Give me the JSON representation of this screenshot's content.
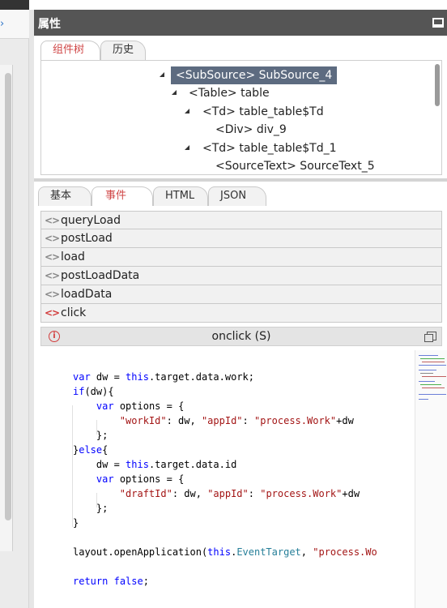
{
  "panel": {
    "title": "属性"
  },
  "top_tabs": [
    "组件树",
    "历史"
  ],
  "tree": [
    {
      "label": "<SubSource> SubSource_4",
      "selected": true
    },
    {
      "label": "<Table> table"
    },
    {
      "label": "<Td> table_table$Td"
    },
    {
      "label": "<Div> div_9"
    },
    {
      "label": "<Td> table_table$Td_1"
    },
    {
      "label": "<SourceText> SourceText_5"
    }
  ],
  "mid_tabs": [
    "基本",
    "事件",
    "HTML",
    "JSON"
  ],
  "events": [
    {
      "label": "queryLoad"
    },
    {
      "label": "postLoad"
    },
    {
      "label": "load"
    },
    {
      "label": "postLoadData"
    },
    {
      "label": "loadData"
    },
    {
      "label": "click",
      "active": true
    }
  ],
  "editor": {
    "title": "onclick (S)",
    "lines": [
      "var dw = this.target.data.work;",
      "if(dw){",
      "    var options = {",
      "        \"workId\": dw, \"appId\": \"process.Work\"+dw",
      "    };",
      "}else{",
      "    dw = this.target.data.id",
      "    var options = {",
      "        \"draftId\": dw, \"appId\": \"process.Work\"+dw",
      "    };",
      "}",
      "layout.openApplication(this.EventTarget, \"process.Wo",
      "return false;"
    ]
  },
  "colors": {
    "header_bg": "#555555",
    "accent": "#d23c3c",
    "selection": "#5d6b80"
  },
  "icons": {
    "minimize": "minimize-icon",
    "event": "code-brackets-icon",
    "info": "info-icon",
    "maximize": "maximize-icon"
  }
}
